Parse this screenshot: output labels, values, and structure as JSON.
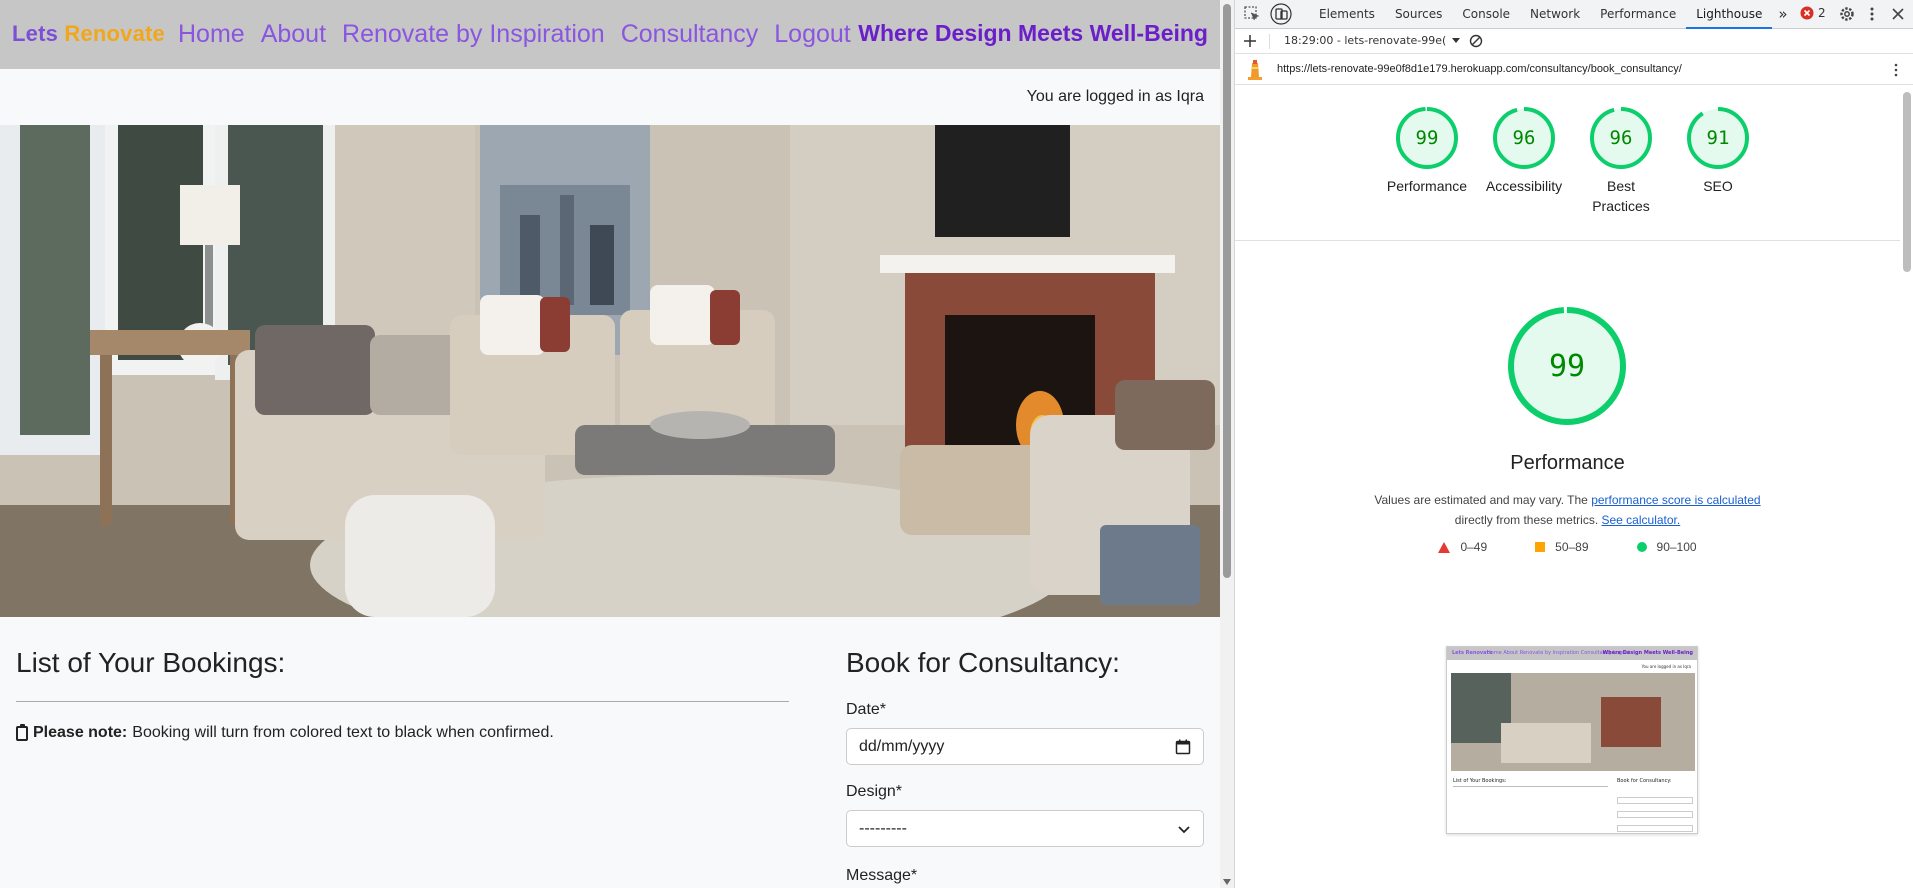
{
  "site": {
    "brand_part1": "Lets",
    "brand_part2": "Renovate",
    "nav": [
      {
        "label": "Home"
      },
      {
        "label": "About"
      },
      {
        "label": "Renovate by Inspiration"
      },
      {
        "label": "Consultancy"
      },
      {
        "label": "Logout"
      }
    ],
    "tagline": "Where Design Meets Well-Being",
    "logged_in": "You are logged in as Iqra",
    "colors": {
      "brand_purple": "#8a55e0",
      "brand_orange": "#f2a71b",
      "tagline_purple": "#6a1fc9",
      "navbar_bg": "#c6c6c6"
    }
  },
  "bookings": {
    "title": "List of Your Bookings:",
    "note_bold": "Please note:",
    "note_text": "Booking will turn from colored text to black when confirmed."
  },
  "consultancy": {
    "title": "Book for Consultancy:",
    "date_label": "Date*",
    "date_placeholder": "dd/mm/yyyy",
    "design_label": "Design*",
    "design_value": "---------",
    "message_label": "Message*"
  },
  "devtools": {
    "tabs": [
      "Elements",
      "Sources",
      "Console",
      "Network",
      "Performance",
      "Lighthouse"
    ],
    "active_tab": "Lighthouse",
    "more_tabs": "»",
    "error_count": "2",
    "report_selector": "18:29:00 - lets-renovate-99e(",
    "url": "https://lets-renovate-99e0f8d1e179.herokuapp.com/consultancy/book_consultancy/",
    "scores": [
      {
        "label": "Performance",
        "value": 99
      },
      {
        "label": "Accessibility",
        "value": 96
      },
      {
        "label": "Best Practices",
        "value": 96
      },
      {
        "label": "SEO",
        "value": 91
      }
    ],
    "performance": {
      "title": "Performance",
      "score": 99,
      "desc_1": "Values are estimated and may vary. The",
      "desc_link1": "performance score is calculated",
      "desc_2": "directly from these metrics.",
      "desc_link2": "See calculator.",
      "legend": [
        {
          "range": "0–49",
          "color": "#e53935",
          "shape": "triangle"
        },
        {
          "range": "50–89",
          "color": "#ffa400",
          "shape": "square"
        },
        {
          "range": "90–100",
          "color": "#0cce6b",
          "shape": "circle"
        }
      ]
    },
    "thumbnail": {
      "brand": "Lets Renovate",
      "nav": "Home About Renovate by Inspiration Consultancy Logout",
      "tagline": "Where Design Meets Well-Being",
      "logged": "You are logged in as Iqra",
      "bookings": "List of Your Bookings:",
      "consult": "Book for Consultancy:"
    },
    "colors": {
      "pass_green": "#0cce6b",
      "pass_text": "#008800",
      "gauge_fill": "#e5faef",
      "active_tab": "#1a73e8"
    }
  }
}
